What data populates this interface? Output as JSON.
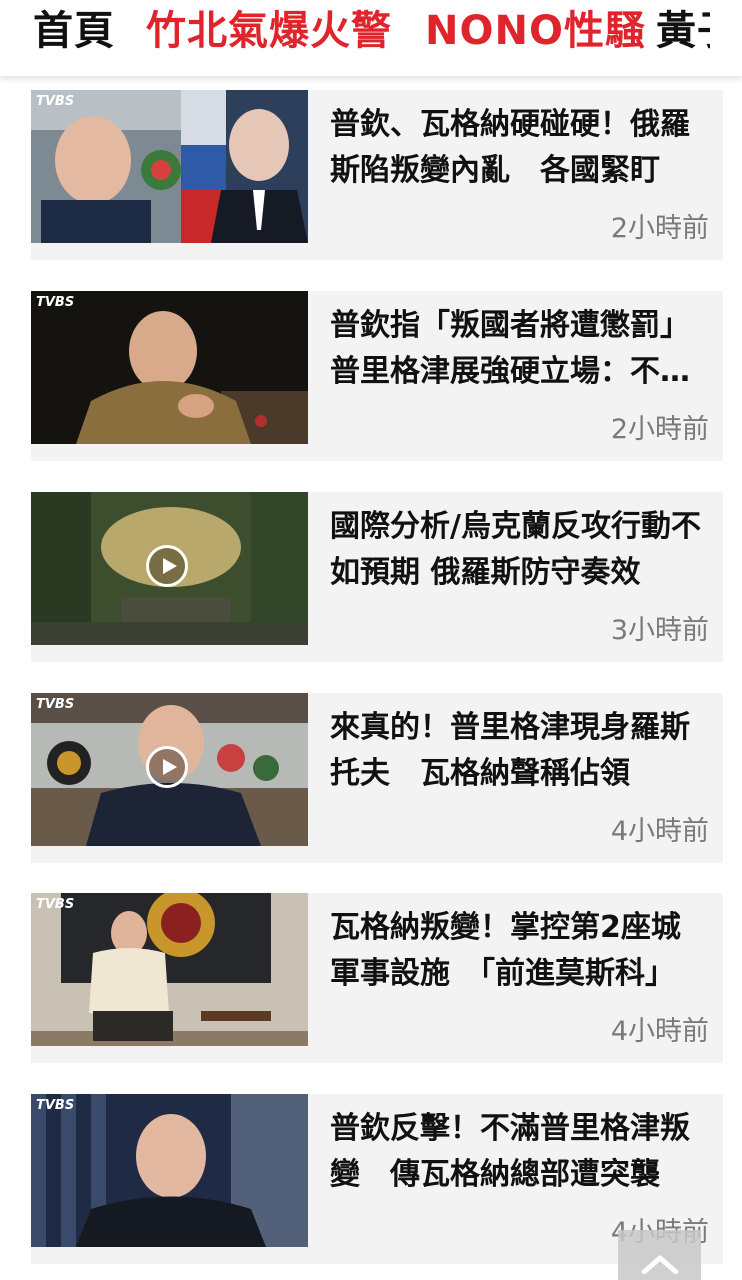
{
  "nav": {
    "items": [
      "首頁",
      "竹北氣爆火警",
      "NONO性騷",
      "黃子"
    ]
  },
  "logo_text": "TVBS",
  "articles": [
    {
      "title": "普欽、瓦格納硬碰硬！俄羅斯陷叛變內亂　各國緊盯",
      "time": "2小時前",
      "video": false
    },
    {
      "title": "普欽指「叛國者將遭懲罰」普里格津展強硬立場：不會投降",
      "time": "2小時前",
      "video": false
    },
    {
      "title": "國際分析/烏克蘭反攻行動不如預期 俄羅斯防守奏效",
      "time": "3小時前",
      "video": true
    },
    {
      "title": "來真的！普里格津現身羅斯托夫　瓦格納聲稱佔領",
      "time": "4小時前",
      "video": true
    },
    {
      "title": "瓦格納叛變！掌控第2座城軍事設施　「前進莫斯科」",
      "time": "4小時前",
      "video": false
    },
    {
      "title": "普欽反擊！不滿普里格津叛變　傳瓦格納總部遭突襲",
      "time": "4小時前",
      "video": false
    }
  ],
  "colors": {
    "nav_highlight": "#e0242c",
    "card_bg": "#f3f3f3",
    "time_text": "#7a7a7a"
  }
}
